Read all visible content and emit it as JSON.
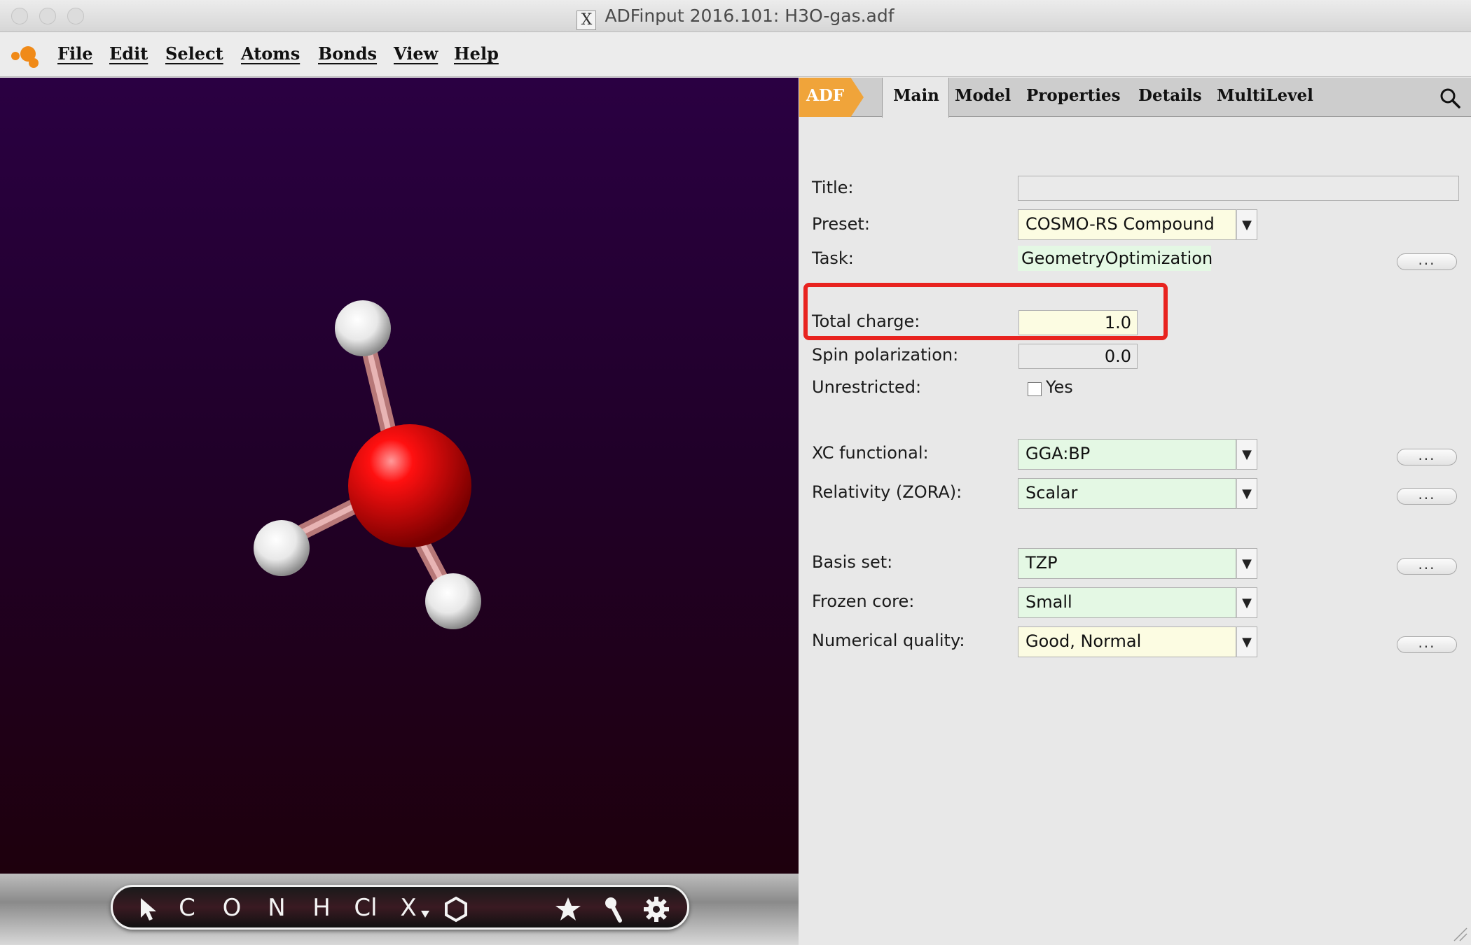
{
  "window": {
    "title": "ADFinput 2016.101: H3O-gas.adf"
  },
  "menu": [
    "File",
    "Edit",
    "Select",
    "Atoms",
    "Bonds",
    "View",
    "Help"
  ],
  "tabs": {
    "adf": "ADF",
    "main": "Main",
    "model": "Model",
    "properties": "Properties",
    "details": "Details",
    "multilevel": "MultiLevel"
  },
  "toolbar": {
    "tools": [
      "C",
      "O",
      "N",
      "H",
      "Cl",
      "X"
    ]
  },
  "form": {
    "title": {
      "label": "Title:",
      "value": ""
    },
    "preset": {
      "label": "Preset:",
      "value": "COSMO-RS Compound"
    },
    "task": {
      "label": "Task:",
      "value": "GeometryOptimization"
    },
    "total_charge": {
      "label": "Total charge:",
      "value": "1.0"
    },
    "spin_polarization": {
      "label": "Spin polarization:",
      "value": "0.0"
    },
    "unrestricted": {
      "label": "Unrestricted:",
      "option": "Yes",
      "checked": false
    },
    "xc_functional": {
      "label": "XC functional:",
      "value": "GGA:BP"
    },
    "relativity": {
      "label": "Relativity (ZORA):",
      "value": "Scalar"
    },
    "basis_set": {
      "label": "Basis set:",
      "value": "TZP"
    },
    "frozen_core": {
      "label": "Frozen core:",
      "value": "Small"
    },
    "numerical_quality": {
      "label": "Numerical quality:",
      "value": "Good, Normal"
    },
    "more_label": "..."
  },
  "colors": {
    "adf_tab": "#f0a43a",
    "highlight": "#e8231f",
    "oxygen": "#e00000",
    "hydrogen": "#ffffff"
  }
}
